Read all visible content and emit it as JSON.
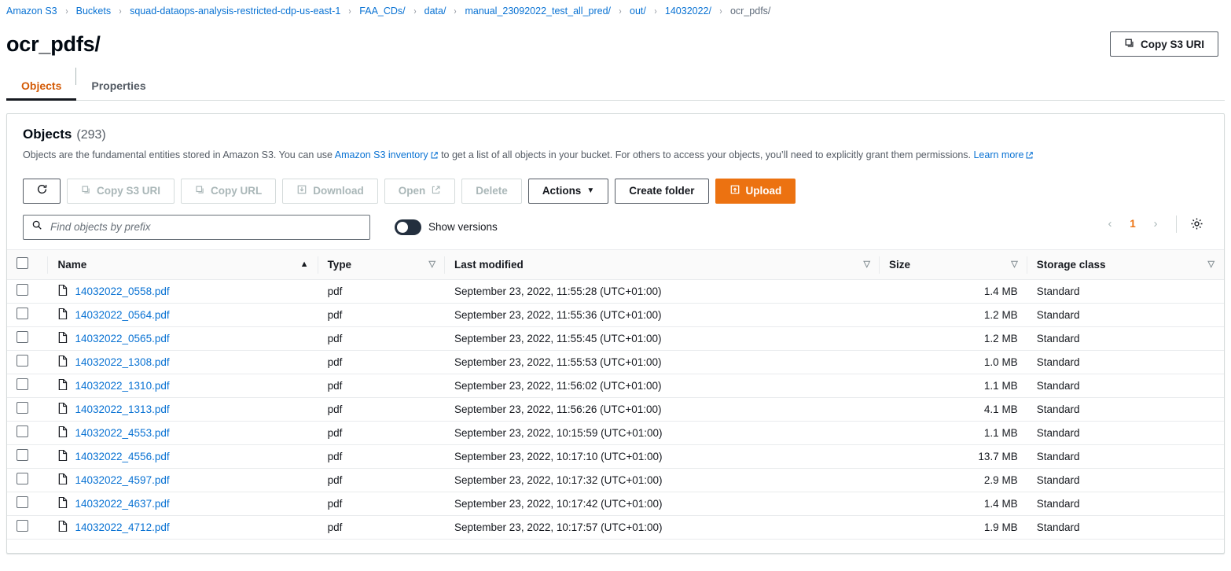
{
  "breadcrumb": [
    {
      "label": "Amazon S3",
      "current": false
    },
    {
      "label": "Buckets",
      "current": false
    },
    {
      "label": "squad-dataops-analysis-restricted-cdp-us-east-1",
      "current": false
    },
    {
      "label": "FAA_CDs/",
      "current": false
    },
    {
      "label": "data/",
      "current": false
    },
    {
      "label": "manual_23092022_test_all_pred/",
      "current": false
    },
    {
      "label": "out/",
      "current": false
    },
    {
      "label": "14032022/",
      "current": false
    },
    {
      "label": "ocr_pdfs/",
      "current": true
    }
  ],
  "header": {
    "title": "ocr_pdfs/",
    "copy_uri_label": "Copy S3 URI"
  },
  "tabs": [
    {
      "label": "Objects",
      "active": true
    },
    {
      "label": "Properties",
      "active": false
    }
  ],
  "panel": {
    "title": "Objects",
    "count": "(293)",
    "description_1": "Objects are the fundamental entities stored in Amazon S3. You can use ",
    "inventory_link": "Amazon S3 inventory",
    "description_2": " to get a list of all objects in your bucket. For others to access your objects, you’ll need to explicitly grant them permissions. ",
    "learn_more_link": "Learn more"
  },
  "toolbar": {
    "refresh_label": "refresh-icon",
    "copy_s3_uri": "Copy S3 URI",
    "copy_url": "Copy URL",
    "download": "Download",
    "open": "Open",
    "delete": "Delete",
    "actions": "Actions",
    "create_folder": "Create folder",
    "upload": "Upload"
  },
  "filter": {
    "placeholder": "Find objects by prefix",
    "value": "",
    "show_versions_label": "Show versions",
    "show_versions_on": false
  },
  "pagination": {
    "prev": "‹",
    "page": "1",
    "next": "›"
  },
  "table": {
    "columns": [
      {
        "label": "Name",
        "sort": "asc"
      },
      {
        "label": "Type",
        "sort": "none"
      },
      {
        "label": "Last modified",
        "sort": "none"
      },
      {
        "label": "Size",
        "sort": "none"
      },
      {
        "label": "Storage class",
        "sort": "none"
      }
    ],
    "rows": [
      {
        "name": "14032022_0558.pdf",
        "type": "pdf",
        "modified": "September 23, 2022, 11:55:28 (UTC+01:00)",
        "size": "1.4 MB",
        "storage": "Standard"
      },
      {
        "name": "14032022_0564.pdf",
        "type": "pdf",
        "modified": "September 23, 2022, 11:55:36 (UTC+01:00)",
        "size": "1.2 MB",
        "storage": "Standard"
      },
      {
        "name": "14032022_0565.pdf",
        "type": "pdf",
        "modified": "September 23, 2022, 11:55:45 (UTC+01:00)",
        "size": "1.2 MB",
        "storage": "Standard"
      },
      {
        "name": "14032022_1308.pdf",
        "type": "pdf",
        "modified": "September 23, 2022, 11:55:53 (UTC+01:00)",
        "size": "1.0 MB",
        "storage": "Standard"
      },
      {
        "name": "14032022_1310.pdf",
        "type": "pdf",
        "modified": "September 23, 2022, 11:56:02 (UTC+01:00)",
        "size": "1.1 MB",
        "storage": "Standard"
      },
      {
        "name": "14032022_1313.pdf",
        "type": "pdf",
        "modified": "September 23, 2022, 11:56:26 (UTC+01:00)",
        "size": "4.1 MB",
        "storage": "Standard"
      },
      {
        "name": "14032022_4553.pdf",
        "type": "pdf",
        "modified": "September 23, 2022, 10:15:59 (UTC+01:00)",
        "size": "1.1 MB",
        "storage": "Standard"
      },
      {
        "name": "14032022_4556.pdf",
        "type": "pdf",
        "modified": "September 23, 2022, 10:17:10 (UTC+01:00)",
        "size": "13.7 MB",
        "storage": "Standard"
      },
      {
        "name": "14032022_4597.pdf",
        "type": "pdf",
        "modified": "September 23, 2022, 10:17:32 (UTC+01:00)",
        "size": "2.9 MB",
        "storage": "Standard"
      },
      {
        "name": "14032022_4637.pdf",
        "type": "pdf",
        "modified": "September 23, 2022, 10:17:42 (UTC+01:00)",
        "size": "1.4 MB",
        "storage": "Standard"
      },
      {
        "name": "14032022_4712.pdf",
        "type": "pdf",
        "modified": "September 23, 2022, 10:17:57 (UTC+01:00)",
        "size": "1.9 MB",
        "storage": "Standard"
      }
    ]
  },
  "colors": {
    "link": "#0972d3",
    "accent_orange": "#ec7211",
    "tab_active": "#d45b07",
    "text": "#16191f",
    "muted": "#545b64",
    "border": "#d5dbdb",
    "toggle_track": "#232f3e"
  }
}
